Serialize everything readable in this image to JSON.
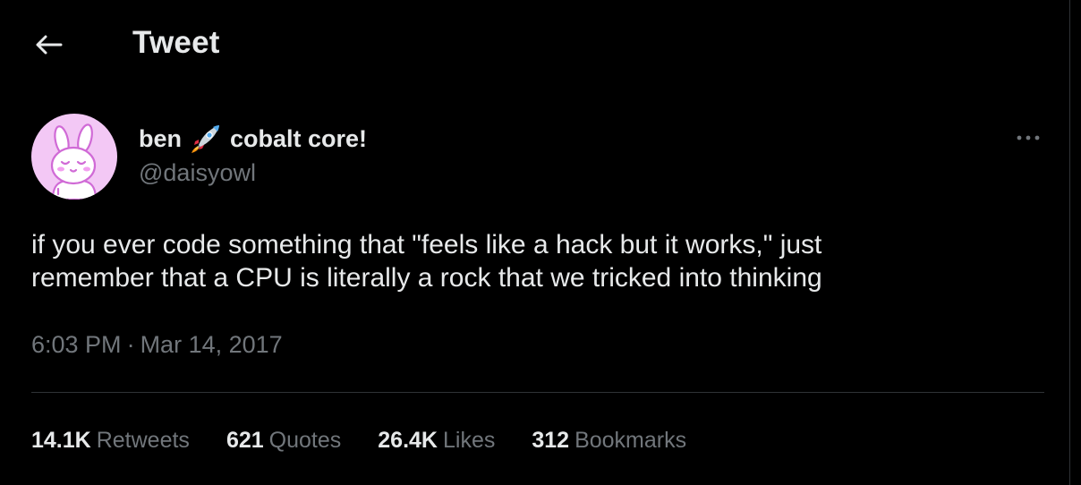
{
  "header": {
    "back_icon": "arrow-left-icon",
    "title": "Tweet"
  },
  "tweet": {
    "author": {
      "name": "ben",
      "name_suffix": "cobalt core!",
      "name_emoji_icon": "rocket-icon",
      "handle": "@daisyowl",
      "avatar_icon": "bunny-avatar",
      "avatar_bg": "#f3c8f5"
    },
    "more_icon": "more-horizontal-icon",
    "text": "if you ever code something that \"feels like a hack but it works,\" just\nremember that a CPU is literally a rock that we tricked into thinking",
    "time": "6:03 PM",
    "separator": "·",
    "date": "Mar 14, 2017",
    "stats": {
      "retweets_count": "14.1K",
      "retweets_label": "Retweets",
      "quotes_count": "621",
      "quotes_label": "Quotes",
      "likes_count": "26.4K",
      "likes_label": "Likes",
      "bookmarks_count": "312",
      "bookmarks_label": "Bookmarks"
    }
  },
  "colors": {
    "background": "#000000",
    "primary_text": "#e7e9ea",
    "secondary_text": "#71767b",
    "border": "#2f3336"
  }
}
